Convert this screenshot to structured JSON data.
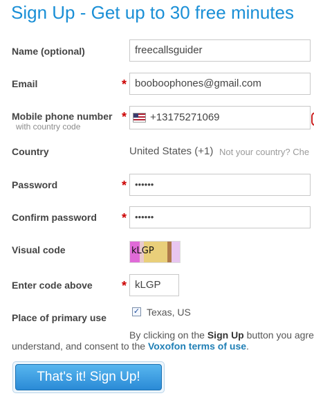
{
  "header": {
    "title": "Sign Up - Get up to 30 free minutes"
  },
  "form": {
    "name_label": "Name (optional)",
    "name_value": "freecallsguider",
    "email_label": "Email",
    "email_value": "booboophones@gmail.com",
    "mobile_label": "Mobile phone number",
    "mobile_sublabel": "with country code",
    "mobile_value": "+13175271069",
    "country_label": "Country",
    "country_value": "United States (+1)",
    "country_change_text": "Not your country? Che",
    "password_label": "Password",
    "password_value": "••••••",
    "confirm_label": "Confirm password",
    "confirm_value": "••••••",
    "visual_label": "Visual code",
    "captcha_text": "kLGP",
    "enter_code_label": "Enter code above",
    "enter_code_value": "kLGP",
    "primary_use_label": "Place of primary use",
    "primary_use_value": "Texas, US",
    "required_marker": "*",
    "checkbox_mark": "✓"
  },
  "terms": {
    "line1_prefix": "By clicking on the",
    "line1_button": "Sign Up",
    "line1_suffix": "button you agre",
    "line2_prefix": "understand, and consent to the",
    "link_text": "Voxofon terms of use",
    "line2_suffix": "."
  },
  "submit": {
    "label": "That's it!  Sign Up!"
  },
  "colors": {
    "title": "#1a8fd6",
    "required": "#cc0000",
    "link": "#1f7fb5",
    "button": "#2a8ad6"
  },
  "icons": {
    "flag": "us-flag-icon"
  }
}
